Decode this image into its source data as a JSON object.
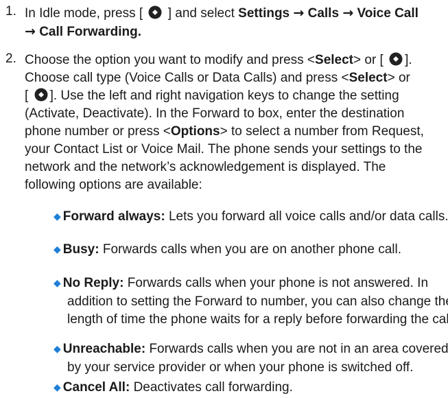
{
  "step1": {
    "number": "1.",
    "l1_pre": "In Idle mode, press [",
    "l1_post": "] and select",
    "l1_settings": "Settings",
    "arrow": "→",
    "l1_calls": "Calls",
    "l1_voice": "Voice Call",
    "l2_callfwd": "Call Forwarding."
  },
  "step2": {
    "number": "2.",
    "l1_pre": "Choose the option you want to modify and press <",
    "select": "Select",
    "l1_mid": "> or [",
    "l1_end": "].",
    "l2_pre": "Choose call type (Voice Calls or Data Calls) and press <",
    "l2_end": "> or",
    "l3_pre": "[",
    "l3_post": "]. Use the left and right navigation keys to change the setting",
    "l4": "(Activate, Deactivate). In the Forward to box, enter the destination",
    "l5_pre": "phone number or press <",
    "options": "Options",
    "l5_post": "> to select a number from Request,",
    "l6": "your Contact List or Voice Mail. The phone sends your settings to the",
    "l7": "network and the network’s acknowledgement is displayed. The",
    "l8": "following options are available:"
  },
  "bullets": [
    {
      "term": "Forward always:",
      "lines": [
        "Lets you forward all voice calls and/or data calls."
      ]
    },
    {
      "term": "Busy:",
      "lines": [
        "Forwards calls when you are on another phone call."
      ]
    },
    {
      "term": "No Reply:",
      "lines": [
        "Forwards calls when your phone is not answered. In",
        "addition to setting the Forward to number, you can also change the",
        "length of time the phone waits for a reply before forwarding the call."
      ]
    },
    {
      "term": "Unreachable:",
      "lines": [
        "Forwards calls when you are not in an area covered",
        "by your service provider or when your phone is switched off."
      ]
    },
    {
      "term": "Cancel All:",
      "lines": [
        "Deactivates call forwarding."
      ]
    }
  ],
  "colors": {
    "bullet": "#1e7fd6",
    "text": "#1a1a1a"
  },
  "icons": {
    "nav_key": "navigation-key-icon",
    "bullet": "diamond-bullet-icon"
  }
}
